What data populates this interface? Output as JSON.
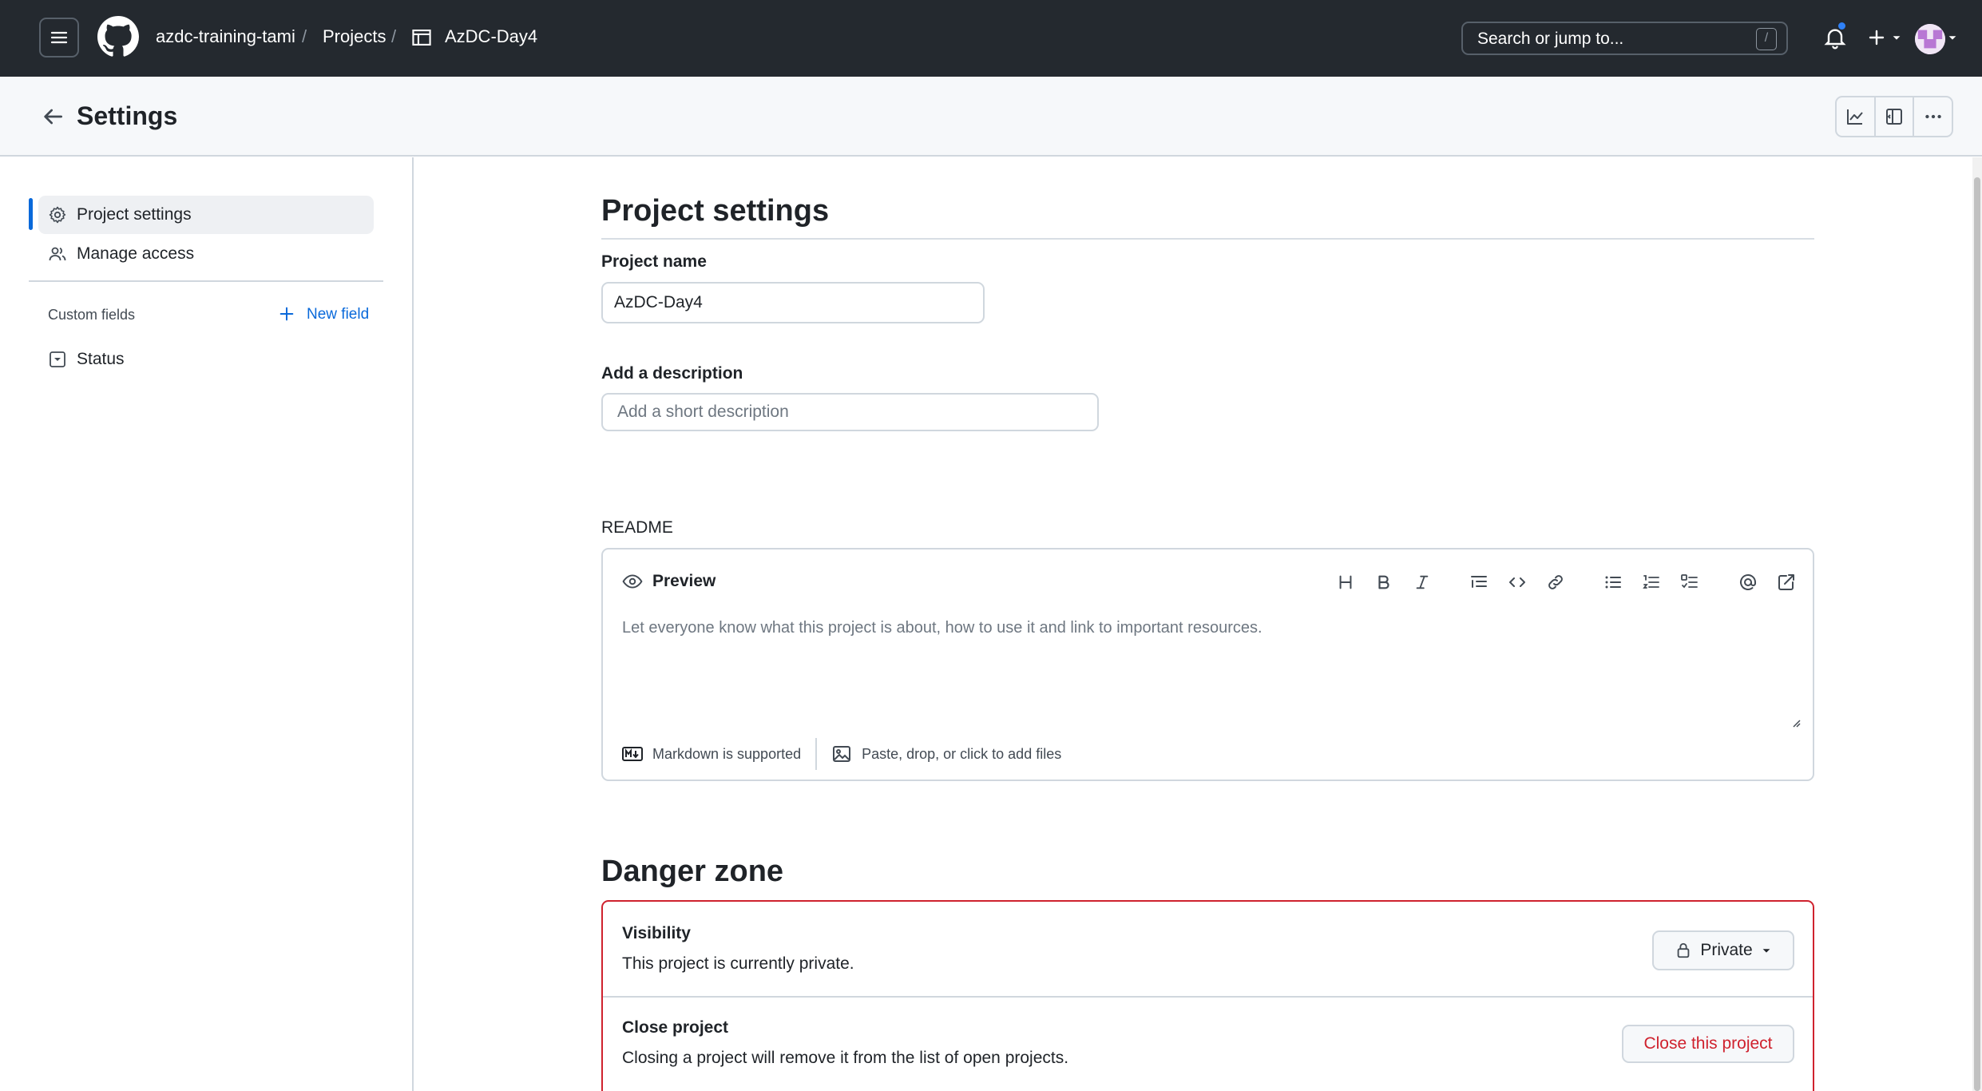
{
  "header": {
    "owner": "azdc-training-tami",
    "projects_label": "Projects",
    "separator": "/",
    "project_name": "AzDC-Day4",
    "search_placeholder": "Search or jump to...",
    "search_shortcut": "/"
  },
  "subheader": {
    "title": "Settings"
  },
  "sidebar": {
    "items": [
      {
        "label": "Project settings",
        "icon": "gear-icon",
        "active": true
      },
      {
        "label": "Manage access",
        "icon": "people-icon",
        "active": false
      }
    ],
    "custom_fields_label": "Custom fields",
    "new_field_label": "New field",
    "fields": [
      {
        "label": "Status",
        "icon": "single-select-icon"
      }
    ]
  },
  "main": {
    "heading": "Project settings",
    "project_name_label": "Project name",
    "project_name_value": "AzDC-Day4",
    "description_label": "Add a description",
    "description_placeholder": "Add a short description",
    "readme_label": "README",
    "preview_tab": "Preview",
    "readme_placeholder": "Let everyone know what this project is about, how to use it and link to important resources.",
    "markdown_note": "Markdown is supported",
    "attach_note": "Paste, drop, or click to add files",
    "toolbar_icons": [
      "heading-icon",
      "bold-icon",
      "italic-icon",
      "quote-icon",
      "code-icon",
      "link-icon",
      "unordered-list-icon",
      "ordered-list-icon",
      "task-list-icon",
      "mention-icon",
      "reference-icon"
    ]
  },
  "danger_zone": {
    "title": "Danger zone",
    "visibility_title": "Visibility",
    "visibility_desc": "This project is currently private.",
    "visibility_button": "Private",
    "close_title": "Close project",
    "close_desc": "Closing a project will remove it from the list of open projects.",
    "close_button": "Close this project"
  },
  "colors": {
    "header_bg": "#24292f",
    "accent": "#0969da",
    "danger": "#cf222e",
    "notification_dot": "#2f81f7"
  }
}
